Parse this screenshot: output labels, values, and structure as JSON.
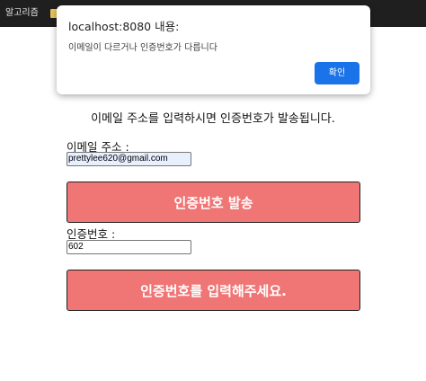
{
  "browser": {
    "bookmark_label": "알고리즘"
  },
  "alert": {
    "title": "localhost:8080 내용:",
    "message": "이메일이 다르거나 인증번호가 다릅니다",
    "ok_label": "확인"
  },
  "form": {
    "instruction": "이메일 주소를 입력하시면 인증번호가 발송됩니다.",
    "email_label": "이메일 주소 :",
    "email_value": "prettylee620@gmail.com",
    "send_button_label": "인증번호 발송",
    "code_label": "인증번호 :",
    "code_value": "602",
    "submit_button_label": "인증번호를 입력해주세요."
  },
  "colors": {
    "button": "#f07575",
    "dialog_ok": "#1a73e8"
  }
}
